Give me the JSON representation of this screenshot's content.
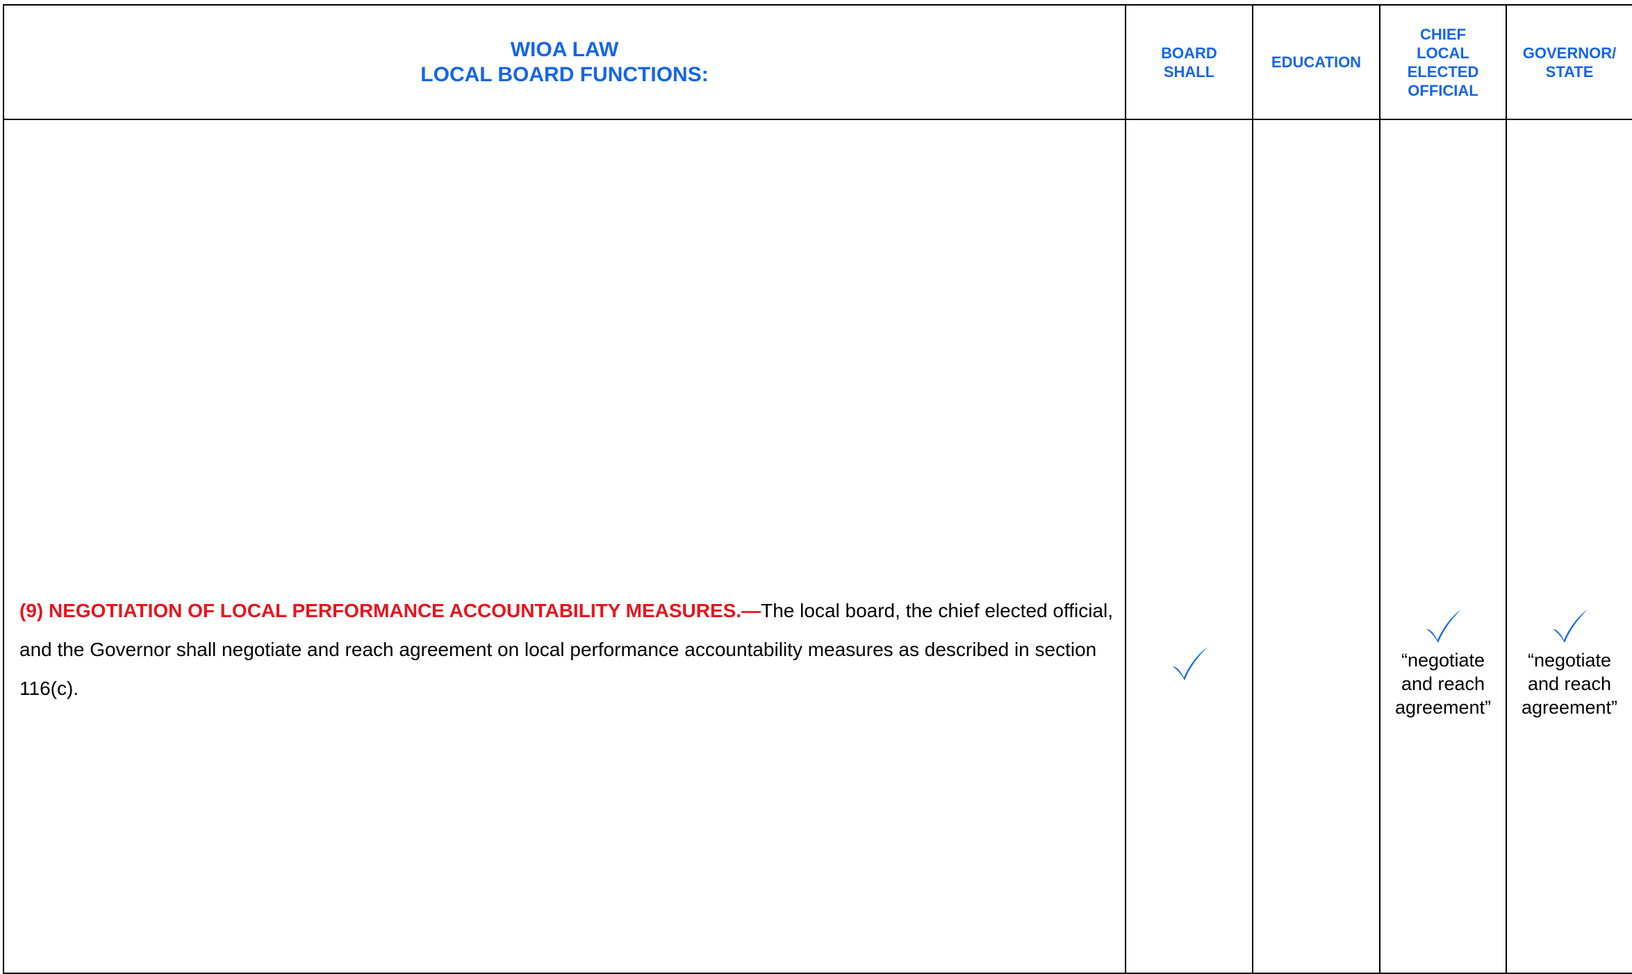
{
  "header": {
    "law_title_line1": "WIOA LAW",
    "law_title_line2": "LOCAL BOARD FUNCTIONS:",
    "columns": [
      {
        "lines": [
          "BOARD",
          "SHALL"
        ]
      },
      {
        "lines": [
          "EDUCATION"
        ]
      },
      {
        "lines": [
          "CHIEF",
          "LOCAL",
          "ELECTED",
          "OFFICIAL"
        ]
      },
      {
        "lines": [
          "GOVERNOR/",
          "STATE"
        ]
      }
    ]
  },
  "row": {
    "heading": "(9) NEGOTIATION OF LOCAL PERFORMANCE ACCOUNTABILITY MEASURES.—",
    "body": "The local board, the chief elected official, and the Governor shall negotiate and reach agreement on local performance accountability measures as described in section 116(c).",
    "marks": {
      "board_shall": true,
      "education": false,
      "chief_local_elected_official": true,
      "governor_state": true
    },
    "ceo_note_lines": [
      "“negotiate",
      "and reach",
      "agreement”"
    ],
    "gov_note_lines": [
      "“negotiate",
      "and reach",
      "agreement”"
    ]
  },
  "colors": {
    "header_blue": "#1565e8",
    "heading_red": "#e8141e",
    "check_blue": "#1565e8"
  },
  "icons": {
    "check": "check-mark-icon"
  }
}
